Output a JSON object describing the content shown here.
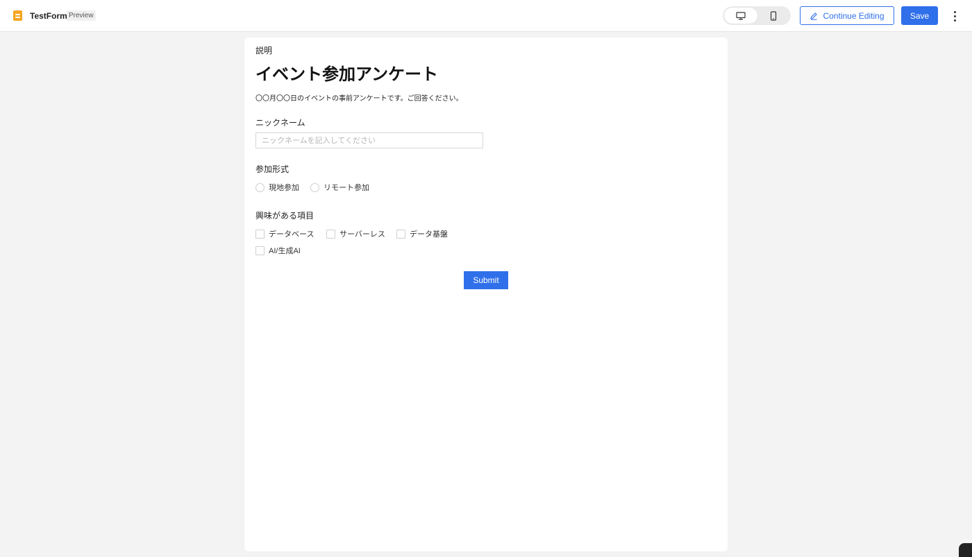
{
  "header": {
    "app_title": "TestForm",
    "mode_badge": "Preview",
    "device_options": [
      {
        "name": "desktop",
        "icon": "desktop-monitor-icon",
        "active": true
      },
      {
        "name": "mobile",
        "icon": "mobile-phone-icon",
        "active": false
      }
    ],
    "continue_label": "Continue Editing",
    "save_label": "Save",
    "more_icon": "more-vertical-icon"
  },
  "form": {
    "section_label": "説明",
    "title": "イベント参加アンケート",
    "description": "〇〇月〇〇日のイベントの事前アンケートです。ご回答ください。",
    "nickname": {
      "label": "ニックネーム",
      "value": "",
      "placeholder": "ニックネームを記入してください"
    },
    "format": {
      "label": "参加形式",
      "options": [
        "現地参加",
        "リモート参加"
      ]
    },
    "interest": {
      "label": "興味がある項目",
      "options": [
        "データベース",
        "サーバーレス",
        "データ基盤",
        "AI/生成AI"
      ]
    },
    "submit_label": "Submit"
  },
  "colors": {
    "accent": "#2f6fea",
    "app_icon": "#f5a623",
    "page_background": "#f3f3f3"
  }
}
